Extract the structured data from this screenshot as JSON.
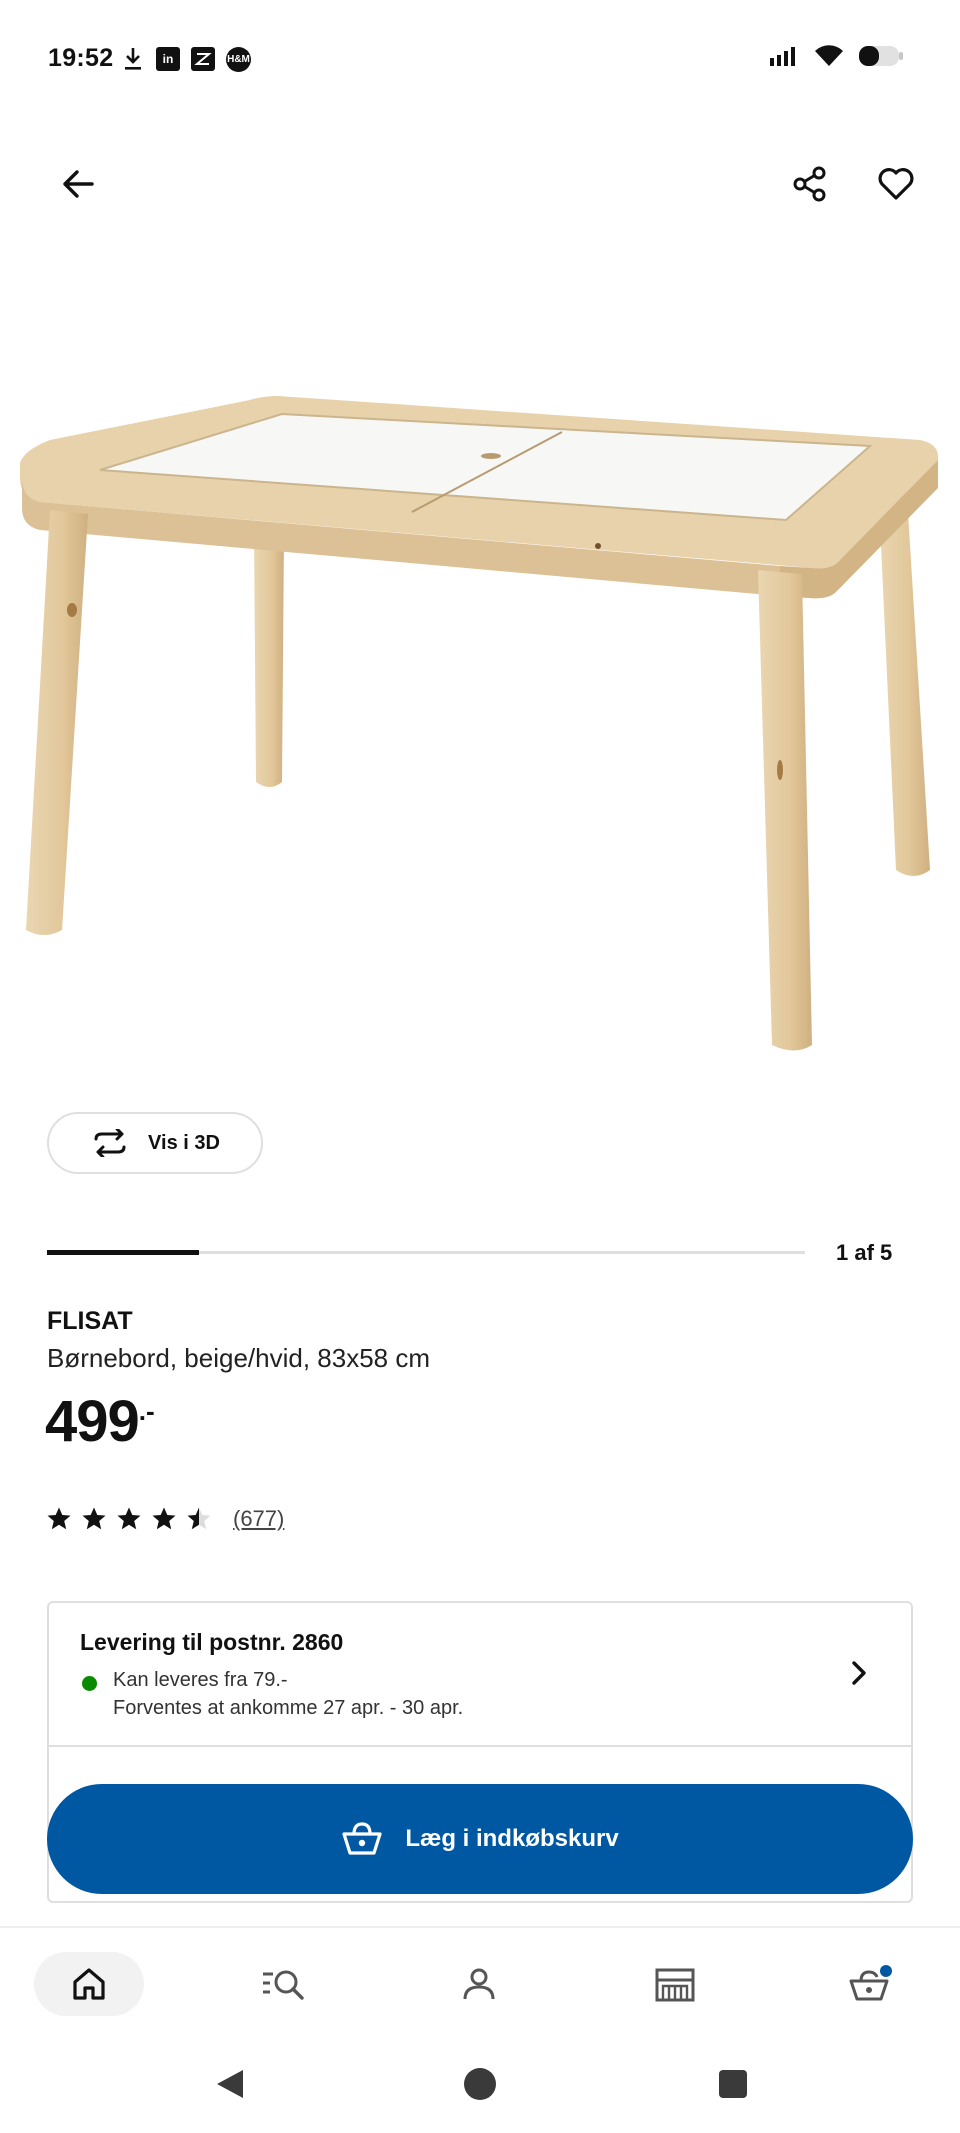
{
  "status_bar": {
    "time": "19:52",
    "left_icons": [
      "download-icon",
      "linkedin-icon",
      "zalando-icon",
      "hm-icon"
    ],
    "linkedin_text": "in",
    "hm_text": "H&M",
    "right_icons": [
      "signal-icon",
      "wifi-icon",
      "battery-icon"
    ]
  },
  "header": {
    "back_icon": "arrow-left-icon",
    "share_icon": "share-icon",
    "favorite_icon": "heart-icon"
  },
  "product": {
    "view_3d_label": "Vis i 3D",
    "carousel": {
      "current": 1,
      "total": 5,
      "label": "1 af 5",
      "progress": 0.2
    },
    "name": "FLISAT",
    "description": "Børnebord, beige/hvid, 83x58 cm",
    "price": {
      "amount": "499",
      "suffix": ".-"
    },
    "rating": {
      "value": 4.5,
      "max": 5,
      "count_label": "(677)"
    }
  },
  "delivery": {
    "title": "Levering til postnr. 2860",
    "availability_line1": "Kan leveres fra 79.-",
    "availability_line2": "Forventes at ankomme 27 apr. - 30 apr."
  },
  "cart_button": {
    "label": "Læg i indkøbskurv",
    "icon": "basket-icon"
  },
  "bottom_nav": {
    "items": [
      "home-icon",
      "search-list-icon",
      "account-icon",
      "store-icon",
      "cart-icon"
    ],
    "active": "home"
  },
  "system_nav": [
    "back-triangle-icon",
    "home-circle-icon",
    "recents-square-icon"
  ],
  "colors": {
    "brand_blue": "#0058a3",
    "availability_green": "#0a8a00",
    "notification_dot": "#0058a3",
    "wood": "#e8d3ad"
  }
}
